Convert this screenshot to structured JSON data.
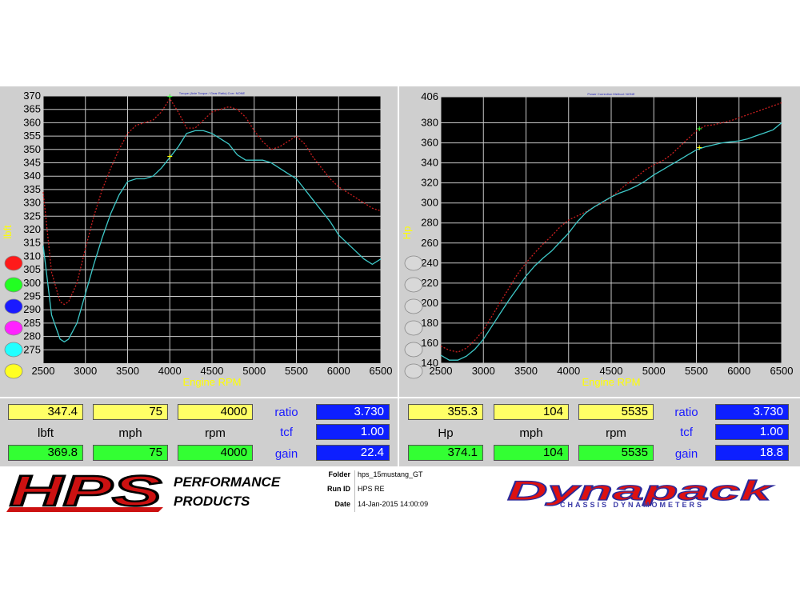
{
  "chart_data": [
    {
      "type": "line",
      "title": "Torque (Axle Torque / Gear Ratio)   Corr: NONE",
      "xlabel": "Engine RPM",
      "ylabel": "lbft",
      "xlim": [
        2500,
        6500
      ],
      "ylim": [
        270,
        370
      ],
      "xticks": [
        "2500",
        "3000",
        "3500",
        "4000",
        "4500",
        "5000",
        "5500",
        "6000",
        "6500"
      ],
      "yticks": [
        "275",
        "280",
        "285",
        "290",
        "295",
        "300",
        "305",
        "310",
        "315",
        "320",
        "325",
        "330",
        "335",
        "340",
        "345",
        "350",
        "355",
        "360",
        "365",
        "370"
      ],
      "grid": true,
      "series": [
        {
          "color": "#cc1f1f",
          "style": "dotted",
          "x": [
            2500,
            2600,
            2700,
            2750,
            2800,
            2900,
            3000,
            3100,
            3200,
            3300,
            3400,
            3500,
            3600,
            3700,
            3800,
            3900,
            4000,
            4100,
            4200,
            4300,
            4400,
            4500,
            4600,
            4700,
            4800,
            4900,
            5000,
            5100,
            5200,
            5300,
            5400,
            5500,
            5600,
            5700,
            5800,
            5900,
            6000,
            6100,
            6200,
            6300,
            6400,
            6500
          ],
          "values": [
            334,
            304,
            293,
            292,
            293,
            300,
            313,
            325,
            335,
            343,
            350,
            356,
            359,
            360,
            361,
            364,
            369,
            364,
            358,
            358,
            361,
            364,
            365,
            366,
            365,
            362,
            357,
            353,
            350,
            351,
            353,
            355,
            352,
            347,
            343,
            339,
            336,
            334,
            332,
            330,
            328,
            327
          ]
        },
        {
          "color": "#3ec8c8",
          "style": "solid",
          "x": [
            2500,
            2600,
            2700,
            2750,
            2800,
            2900,
            3000,
            3100,
            3200,
            3300,
            3400,
            3500,
            3600,
            3700,
            3800,
            3900,
            4000,
            4100,
            4200,
            4300,
            4400,
            4500,
            4600,
            4700,
            4800,
            4900,
            5000,
            5100,
            5200,
            5300,
            5400,
            5500,
            5600,
            5700,
            5800,
            5900,
            6000,
            6100,
            6200,
            6300,
            6400,
            6500
          ],
          "values": [
            314,
            288,
            279,
            278,
            279,
            285,
            296,
            307,
            317,
            326,
            333,
            338,
            339,
            339,
            340,
            343,
            347,
            351,
            356,
            357,
            357,
            356,
            354,
            352,
            348,
            346,
            346,
            346,
            345,
            343,
            341,
            339,
            335,
            331,
            327,
            323,
            318,
            315,
            312,
            309,
            307,
            309
          ]
        }
      ],
      "markers": [
        {
          "x": 4000,
          "y": 369.8,
          "color": "#33ff33"
        },
        {
          "x": 4000,
          "y": 347.4,
          "color": "#ffff00"
        }
      ]
    },
    {
      "type": "line",
      "title": "Power   Correction Method: NONE",
      "xlabel": "Engine RPM",
      "ylabel": "Hp",
      "xlim": [
        2500,
        6500
      ],
      "ylim": [
        140,
        406
      ],
      "xticks": [
        "2500",
        "3000",
        "3500",
        "4000",
        "4500",
        "5000",
        "5500",
        "6000",
        "6500"
      ],
      "yticks": [
        "140",
        "160",
        "180",
        "200",
        "220",
        "240",
        "260",
        "280",
        "300",
        "320",
        "340",
        "360",
        "380",
        "406"
      ],
      "grid": true,
      "series": [
        {
          "color": "#cc1f1f",
          "style": "dotted",
          "x": [
            2500,
            2600,
            2700,
            2800,
            2900,
            3000,
            3100,
            3200,
            3300,
            3400,
            3500,
            3600,
            3700,
            3800,
            3900,
            4000,
            4100,
            4200,
            4300,
            4400,
            4500,
            4600,
            4700,
            4800,
            4900,
            5000,
            5100,
            5200,
            5300,
            5400,
            5500,
            5600,
            5700,
            5800,
            5900,
            6000,
            6100,
            6200,
            6300,
            6400,
            6500
          ],
          "values": [
            157,
            153,
            151,
            155,
            163,
            173,
            187,
            201,
            215,
            229,
            240,
            250,
            259,
            267,
            276,
            283,
            287,
            291,
            296,
            300,
            306,
            313,
            320,
            326,
            333,
            338,
            342,
            348,
            356,
            364,
            372,
            377,
            378,
            380,
            382,
            385,
            388,
            391,
            394,
            397,
            400
          ]
        },
        {
          "color": "#3ec8c8",
          "style": "solid",
          "x": [
            2500,
            2600,
            2700,
            2800,
            2900,
            3000,
            3100,
            3200,
            3300,
            3400,
            3500,
            3600,
            3700,
            3800,
            3900,
            4000,
            4100,
            4200,
            4300,
            4400,
            4500,
            4600,
            4700,
            4800,
            4900,
            5000,
            5100,
            5200,
            5300,
            5400,
            5500,
            5600,
            5700,
            5800,
            5900,
            6000,
            6100,
            6200,
            6300,
            6400,
            6500
          ],
          "values": [
            148,
            143,
            143,
            147,
            154,
            164,
            177,
            190,
            203,
            215,
            227,
            237,
            245,
            252,
            261,
            270,
            281,
            290,
            296,
            301,
            306,
            310,
            313,
            317,
            322,
            328,
            333,
            338,
            343,
            348,
            353,
            356,
            358,
            360,
            361,
            362,
            364,
            367,
            370,
            373,
            380
          ]
        }
      ],
      "markers": [
        {
          "x": 5535,
          "y": 374.1,
          "color": "#33ff33"
        },
        {
          "x": 5535,
          "y": 355.3,
          "color": "#ffff00"
        }
      ]
    }
  ],
  "left_swatches": [
    "#ff1a1a",
    "#22ff22",
    "#1a1aff",
    "#ff22ff",
    "#22ffff",
    "#ffff22"
  ],
  "right_swatches": [
    "#d8d8d8",
    "#d8d8d8",
    "#d8d8d8",
    "#d8d8d8",
    "#d8d8d8",
    "#d8d8d8"
  ],
  "readout_left": {
    "row1": [
      "347.4",
      "75",
      "4000"
    ],
    "labels": [
      "lbft",
      "mph",
      "rpm"
    ],
    "row3": [
      "369.8",
      "75",
      "4000"
    ],
    "side_labels": [
      "ratio",
      "tcf",
      "gain"
    ],
    "side_values": [
      "3.730",
      "1.00",
      "22.4"
    ]
  },
  "readout_right": {
    "row1": [
      "355.3",
      "104",
      "5535"
    ],
    "labels": [
      "Hp",
      "mph",
      "rpm"
    ],
    "row3": [
      "374.1",
      "104",
      "5535"
    ],
    "side_labels": [
      "ratio",
      "tcf",
      "gain"
    ],
    "side_values": [
      "3.730",
      "1.00",
      "18.8"
    ]
  },
  "footer": {
    "folder_label": "Folder",
    "folder_value": "hps_15mustang_GT",
    "runid_label": "Run ID",
    "runid_value": "HPS RE",
    "date_label": "Date",
    "date_value": "14-Jan-2015  14:00:09"
  },
  "logos": {
    "hps": "HPS",
    "hps_line1": "PERFORMANCE",
    "hps_line2": "PRODUCTS",
    "dynapack": "Dynapack",
    "dynapack_sub": "CHASSIS DYNAMOMETERS"
  }
}
